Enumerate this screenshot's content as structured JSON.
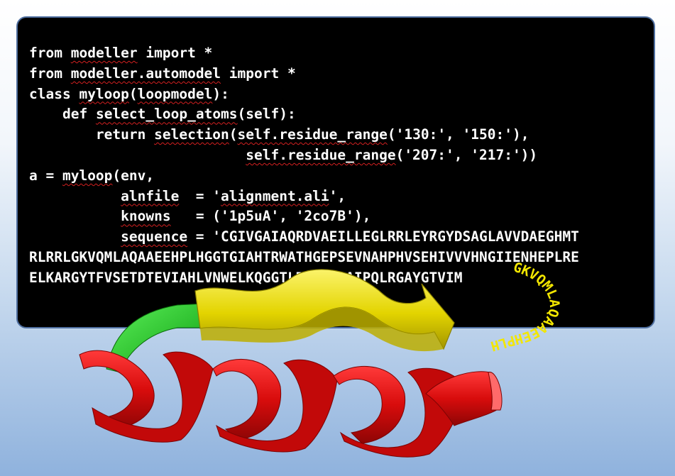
{
  "code": {
    "line1": {
      "kw1": "from",
      "mod": "modeller",
      "rest": " import *"
    },
    "line2": {
      "kw1": "from",
      "mod": "modeller.automodel",
      "rest": " import *"
    },
    "line3": {
      "kw": "class",
      "cls": "myloop",
      "open": "(",
      "base": "loopmodel",
      "close": "):"
    },
    "line4": {
      "indent": "    ",
      "kw": "def",
      "fn": "select_loop_atoms",
      "rest": "(self):"
    },
    "line5": {
      "indent": "        ",
      "kw": "return",
      "fn": "selection",
      "open": "(",
      "call": "self.residue_range",
      "args": "('130:', '150:'),"
    },
    "line6": {
      "indent": "                  ",
      "call": "self.residue_range",
      "args": "('207:', '217:'))"
    },
    "line7": {
      "pre": "a = ",
      "fn": "myloop",
      "rest": "(env,"
    },
    "line8": {
      "indent": "           ",
      "name": "alnfile",
      "eq": "  = '",
      "val": "alignment.ali",
      "end": "',"
    },
    "line9": {
      "indent": "           ",
      "name": "knowns",
      "rest": "   = ('1p5uA', '2co7B'),"
    },
    "line10": {
      "indent": "           ",
      "name": "sequence",
      "rest": " = 'CGIVGAIAQRDVAEILLEGLRRLEYRGYDSAGLAVVDAEGHMT"
    },
    "line11": "RLRRLGKVQMLAQAAEEHPLHGGTGIAHTRWATHGEPSEVNAHPHVSEHIVVVHNGIIENHEPLRE",
    "line12": "ELKARGYTFVSETDTEVIAHLVNWELKQGGTLREAVLRAIPQLRGAYGTVIM"
  },
  "curved_sequence": "GKVQMLAQAAEEHPLH",
  "colors": {
    "panel_background": "#000000",
    "panel_border": "#4f6fa0",
    "code_text": "#ffffff",
    "spellcheck_underline": "#d42020",
    "strand": "#f2e600",
    "loop": "#19d61c",
    "helix": "#e00f0f",
    "curved_text": "#f2e600"
  },
  "icons": [
    "protein-helix-ribbon",
    "protein-strand-arrow",
    "protein-loop-tube"
  ]
}
